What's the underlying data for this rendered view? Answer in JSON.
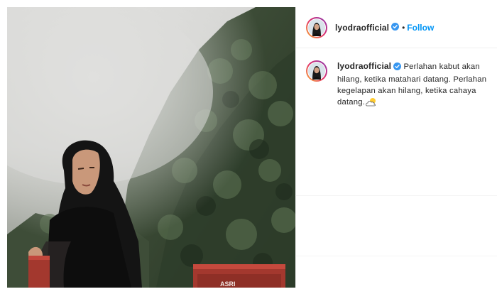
{
  "post": {
    "image_alt": "Young woman looking back over her shoulder in front of a misty forested mountain",
    "sign_text": "ASRI"
  },
  "header": {
    "username": "lyodraofficial",
    "separator": "•",
    "follow_label": "Follow"
  },
  "caption": {
    "username": "lyodraofficial",
    "line1": "Perlahan kabut akan hilang, ketika matahari datang.",
    "line2": "Perlahan kegelapan akan hilang, ketika cahaya datang.",
    "emoji_icon": "sun-behind-cloud-icon"
  },
  "colors": {
    "accent_blue": "#0095f6",
    "verified_blue": "#3897f0",
    "text": "#262626",
    "border": "#efefef"
  }
}
